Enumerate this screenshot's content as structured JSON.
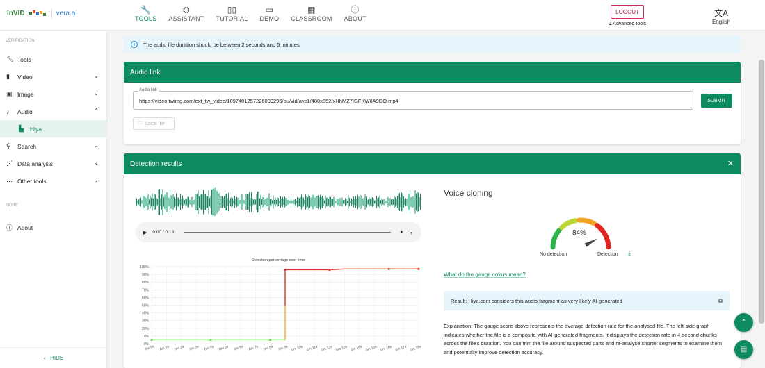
{
  "nav": {
    "logo_invid": "InVID",
    "logo_vera": "vera.ai",
    "items": [
      {
        "label": "TOOLS",
        "icon": "wrench-icon"
      },
      {
        "label": "ASSISTANT",
        "icon": "assistant-icon"
      },
      {
        "label": "TUTORIAL",
        "icon": "book-icon"
      },
      {
        "label": "DEMO",
        "icon": "monitor-icon"
      },
      {
        "label": "CLASSROOM",
        "icon": "classroom-icon"
      },
      {
        "label": "ABOUT",
        "icon": "info-icon"
      }
    ],
    "logout": "LOGOUT",
    "advanced_tools": "Advanced tools",
    "language": "English"
  },
  "sidebar": {
    "section_verification": "VERIFICATION",
    "items": [
      {
        "label": "Tools",
        "icon": "wrench-icon"
      },
      {
        "label": "Video",
        "icon": "film-icon"
      },
      {
        "label": "Image",
        "icon": "image-icon"
      },
      {
        "label": "Audio",
        "icon": "music-icon"
      },
      {
        "label": "Hiya",
        "icon": "hiya-icon"
      },
      {
        "label": "Search",
        "icon": "search-icon"
      },
      {
        "label": "Data analysis",
        "icon": "graph-icon"
      },
      {
        "label": "Other tools",
        "icon": "dots-icon"
      }
    ],
    "section_more": "MORE",
    "about": "About",
    "hide": "HIDE"
  },
  "info_banner": "The audio file duration should be between 2 seconds and 5 minutes.",
  "audio_link": {
    "title": "Audio link",
    "field_label": "Audio link",
    "field_value": "https://video.twimg.com/ext_tw_video/1897401257226039296/pu/vid/avc1/480x852/xHhMZ7IGFKW6A9DO.mp4",
    "submit": "SUBMIT",
    "local_file": "Local file"
  },
  "detection": {
    "title": "Detection results",
    "player_time": "0:00 / 0:18",
    "voice_cloning_title": "Voice cloning",
    "gauge_value": "84%",
    "gauge_fraction": 0.84,
    "gauge_no_detection": "No detection",
    "gauge_detection": "Detection",
    "gauge_colors_link": "What do the gauge colors mean?",
    "result": "Result: Hiya.com considers this audio fragment as very likely AI-generated",
    "explanation": "Explanation: The gauge score above represents the average detection rate for the analysed file. The left-side graph indicates whether the file is a composite with AI-generated fragments. It displays the detection rate in 4-second chunks across the file's duration. You can trim the file around suspected parts and re-analyse shorter segments to examine them and potentially improve detection accuracy."
  },
  "chart_data": {
    "type": "line",
    "title": "Detection percentage over time",
    "x": [
      "0m 0s",
      "0m 1s",
      "0m 2s",
      "0m 3s",
      "0m 4s",
      "0m 5s",
      "0m 6s",
      "0m 7s",
      "0m 8s",
      "0m 9s",
      "0m 10s",
      "0m 11s",
      "0m 12s",
      "0m 13s",
      "0m 14s",
      "0m 15s",
      "0m 16s",
      "0m 17s",
      "0m 18s"
    ],
    "y_ticks": [
      "0%",
      "10%",
      "20%",
      "30%",
      "40%",
      "50%",
      "60%",
      "70%",
      "80%",
      "90%",
      "100%"
    ],
    "ylim": [
      0,
      100
    ],
    "series": [
      {
        "values": [
          5,
          5,
          5,
          5,
          5,
          5,
          5,
          5,
          5,
          96,
          96,
          96,
          96,
          97,
          97,
          97,
          97,
          97,
          97
        ]
      }
    ],
    "colors": {
      "low": "#62c64a",
      "high": "#e0352b",
      "mid": "#e8b02a"
    },
    "grid": true
  }
}
